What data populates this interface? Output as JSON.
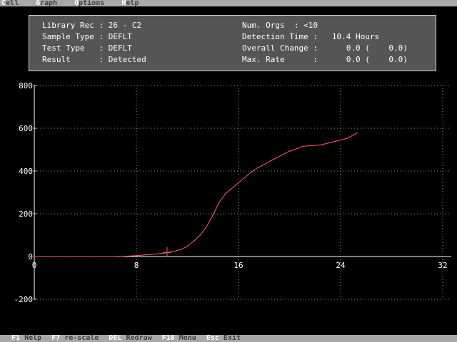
{
  "menu": {
    "items": [
      {
        "hot": "C",
        "rest": "ell"
      },
      {
        "hot": "G",
        "rest": "raph"
      },
      {
        "hot": "O",
        "rest": "ptions"
      },
      {
        "hot": "H",
        "rest": "elp"
      }
    ]
  },
  "info": {
    "library_rec": {
      "label": "Library Rec",
      "value": "26 - C2"
    },
    "sample_type": {
      "label": "Sample Type",
      "value": "DEFLT"
    },
    "test_type": {
      "label": "Test Type",
      "value": "DEFLT"
    },
    "result": {
      "label": "Result",
      "value": "Detected"
    },
    "num_orgs": {
      "label": "Num. Orgs",
      "value": "<10"
    },
    "detection_time": {
      "label": "Detection Time",
      "value": "10.4 Hours"
    },
    "overall_change": {
      "label": "Overall Change",
      "value": "0.0",
      "paren": "0.0"
    },
    "max_rate": {
      "label": "Max. Rate",
      "value": "0.0",
      "paren": "0.0"
    }
  },
  "chart_data": {
    "type": "line",
    "xlim": [
      0,
      32
    ],
    "ylim": [
      -200,
      800
    ],
    "x_ticks": [
      "0",
      "8",
      "16",
      "24",
      "32"
    ],
    "y_ticks": [
      "800",
      "600",
      "400",
      "200",
      "0",
      "-200"
    ],
    "grid": true,
    "series": [
      {
        "color": "#ff6060",
        "x": [
          0,
          1,
          2,
          3,
          4,
          5,
          6,
          7,
          8,
          9,
          10,
          10.4,
          11,
          11.5,
          12,
          12.5,
          13,
          13.5,
          14,
          14.5,
          15,
          15.5,
          16,
          16.5,
          17,
          17.5,
          18,
          18.5,
          19,
          19.5,
          20,
          20.5,
          21,
          21.5,
          22,
          22.5,
          23,
          23.5,
          24,
          24.5,
          25,
          25.3
        ],
        "y": [
          0,
          0,
          0,
          0,
          0,
          0,
          0,
          1,
          4,
          9,
          14,
          18,
          25,
          33,
          48,
          72,
          100,
          140,
          195,
          255,
          295,
          320,
          345,
          370,
          395,
          415,
          430,
          447,
          462,
          478,
          493,
          503,
          515,
          518,
          520,
          523,
          530,
          538,
          545,
          553,
          568,
          578
        ]
      }
    ],
    "marker": {
      "x": 10.4,
      "y": 18
    }
  },
  "function_keys": [
    {
      "key": "F1",
      "label": "Help"
    },
    {
      "key": "F7",
      "label": "re-scale"
    },
    {
      "key": "DEL",
      "label": "Redraw"
    },
    {
      "key": "F10",
      "label": "Menu"
    },
    {
      "key": "Esc",
      "label": "Exit"
    }
  ]
}
